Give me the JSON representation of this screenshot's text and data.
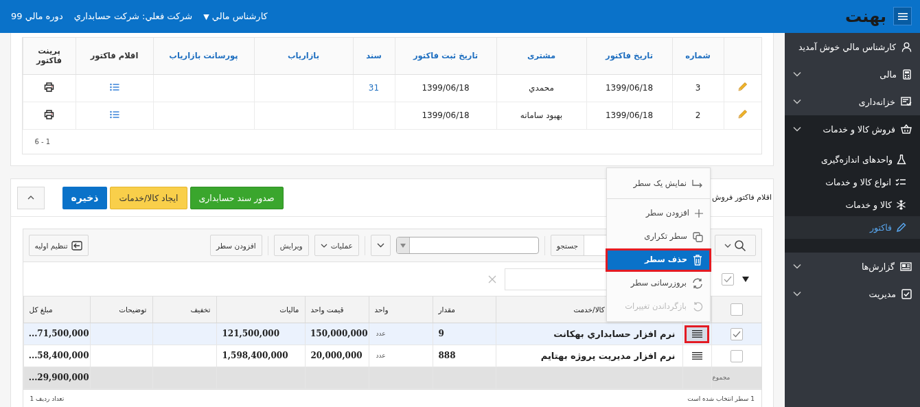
{
  "topbar": {
    "logo": "بهنت",
    "financial_period": "دوره مالي 99",
    "current_company": "شركت فعلي: شركت حسابداري",
    "user_role": "كارشناس مالي",
    "user_caret": "▼"
  },
  "sidebar": {
    "welcome": "كارشناس مالي خوش آمديد",
    "items": [
      {
        "label": "مالی",
        "expanded": false
      },
      {
        "label": "خزانه‌داری",
        "expanded": false
      },
      {
        "label": "فروش کالا و خدمات",
        "expanded": true,
        "children": [
          {
            "label": "واحدهای اندازه‌گیری",
            "selected": false
          },
          {
            "label": "انواع کالا و خدمات",
            "selected": false
          },
          {
            "label": "کالا و خدمات",
            "selected": false
          },
          {
            "label": "فاکتور",
            "selected": true
          }
        ]
      },
      {
        "label": "گزارش‌ها",
        "expanded": false
      },
      {
        "label": "مدیریت",
        "expanded": false
      }
    ]
  },
  "invoices": {
    "columns": [
      {
        "label": "شماره",
        "sortable": true
      },
      {
        "label": "تاریخ فاکتور",
        "sortable": true
      },
      {
        "label": "مشتری",
        "sortable": true
      },
      {
        "label": "تاریخ ثبت فاکتور",
        "sortable": true
      },
      {
        "label": "سند",
        "sortable": true
      },
      {
        "label": "بازاریاب",
        "sortable": true
      },
      {
        "label": "پورسانت بازاریاب",
        "sortable": true
      },
      {
        "label": "اقلام فاکتور",
        "sortable": false
      },
      {
        "label": "پرینت فاکتور",
        "sortable": false
      }
    ],
    "rows": [
      {
        "number": "3",
        "invoice_date": "1399/06/18",
        "customer": "محمدي",
        "registration_date": "1399/06/18",
        "document": "31"
      },
      {
        "number": "2",
        "invoice_date": "1399/06/18",
        "customer": "بهبود سامانه",
        "registration_date": "1399/06/18",
        "document": ""
      }
    ],
    "pager": "1 - 6"
  },
  "items_panel": {
    "title": "اقلام فاكتور فروش",
    "buttons": [
      {
        "label": "صدور سند حسابداری",
        "kind": "success"
      },
      {
        "label": "ایجاد کالا/خدمات",
        "kind": "warning"
      },
      {
        "label": "ذخیره",
        "kind": "primary"
      }
    ],
    "group_row": {
      "checked": true
    },
    "select_all": {
      "checked": false
    },
    "toolbar": {
      "search_button": "جستجو",
      "operations": "عملیات",
      "edit": "ویرایش",
      "add_row": "افزودن سطر",
      "reset": "تنظیم اولیه"
    },
    "columns": [
      "کالا/خدمت",
      "مقدار",
      "واحد",
      "قیمت واحد",
      "مالیات",
      "تخفیف",
      "توضیحات",
      "مبلغ کل"
    ],
    "rows": [
      {
        "selected": true,
        "menu_open": true,
        "product": "نرم افزار حسابداري بهكانت",
        "quantity": "9",
        "unit": "عدد",
        "unit_price": "150,000,000",
        "tax": "121,500,000",
        "discount": "",
        "description": "",
        "total": "71,500,000..."
      },
      {
        "selected": false,
        "menu_open": false,
        "product": "نرم افزار مديريت پروژه بهتايم",
        "quantity": "888",
        "unit": "عدد",
        "unit_price": "20,000,000",
        "tax": "1,598,400,000",
        "discount": "",
        "description": "",
        "total": "58,400,000..."
      }
    ],
    "totals": {
      "label": "مجموع",
      "total": "29,900,000..."
    },
    "footer": {
      "selected_count": "1 سطر انتخاب شده است",
      "row_count": "تعداد ردیف 1"
    }
  },
  "context_menu": {
    "items": [
      {
        "label": "نمایش یک سطر",
        "highlighted": false,
        "disabled": false
      },
      {
        "label": "افزودن سطر",
        "highlighted": false,
        "disabled": false
      },
      {
        "label": "سطر تکراری",
        "highlighted": false,
        "disabled": false
      },
      {
        "label": "حذف سطر",
        "highlighted": true,
        "disabled": false
      },
      {
        "label": "بروزرسانی سطر",
        "highlighted": false,
        "disabled": false
      },
      {
        "label": "بازگرداندن تغییرات",
        "highlighted": false,
        "disabled": true
      }
    ]
  }
}
